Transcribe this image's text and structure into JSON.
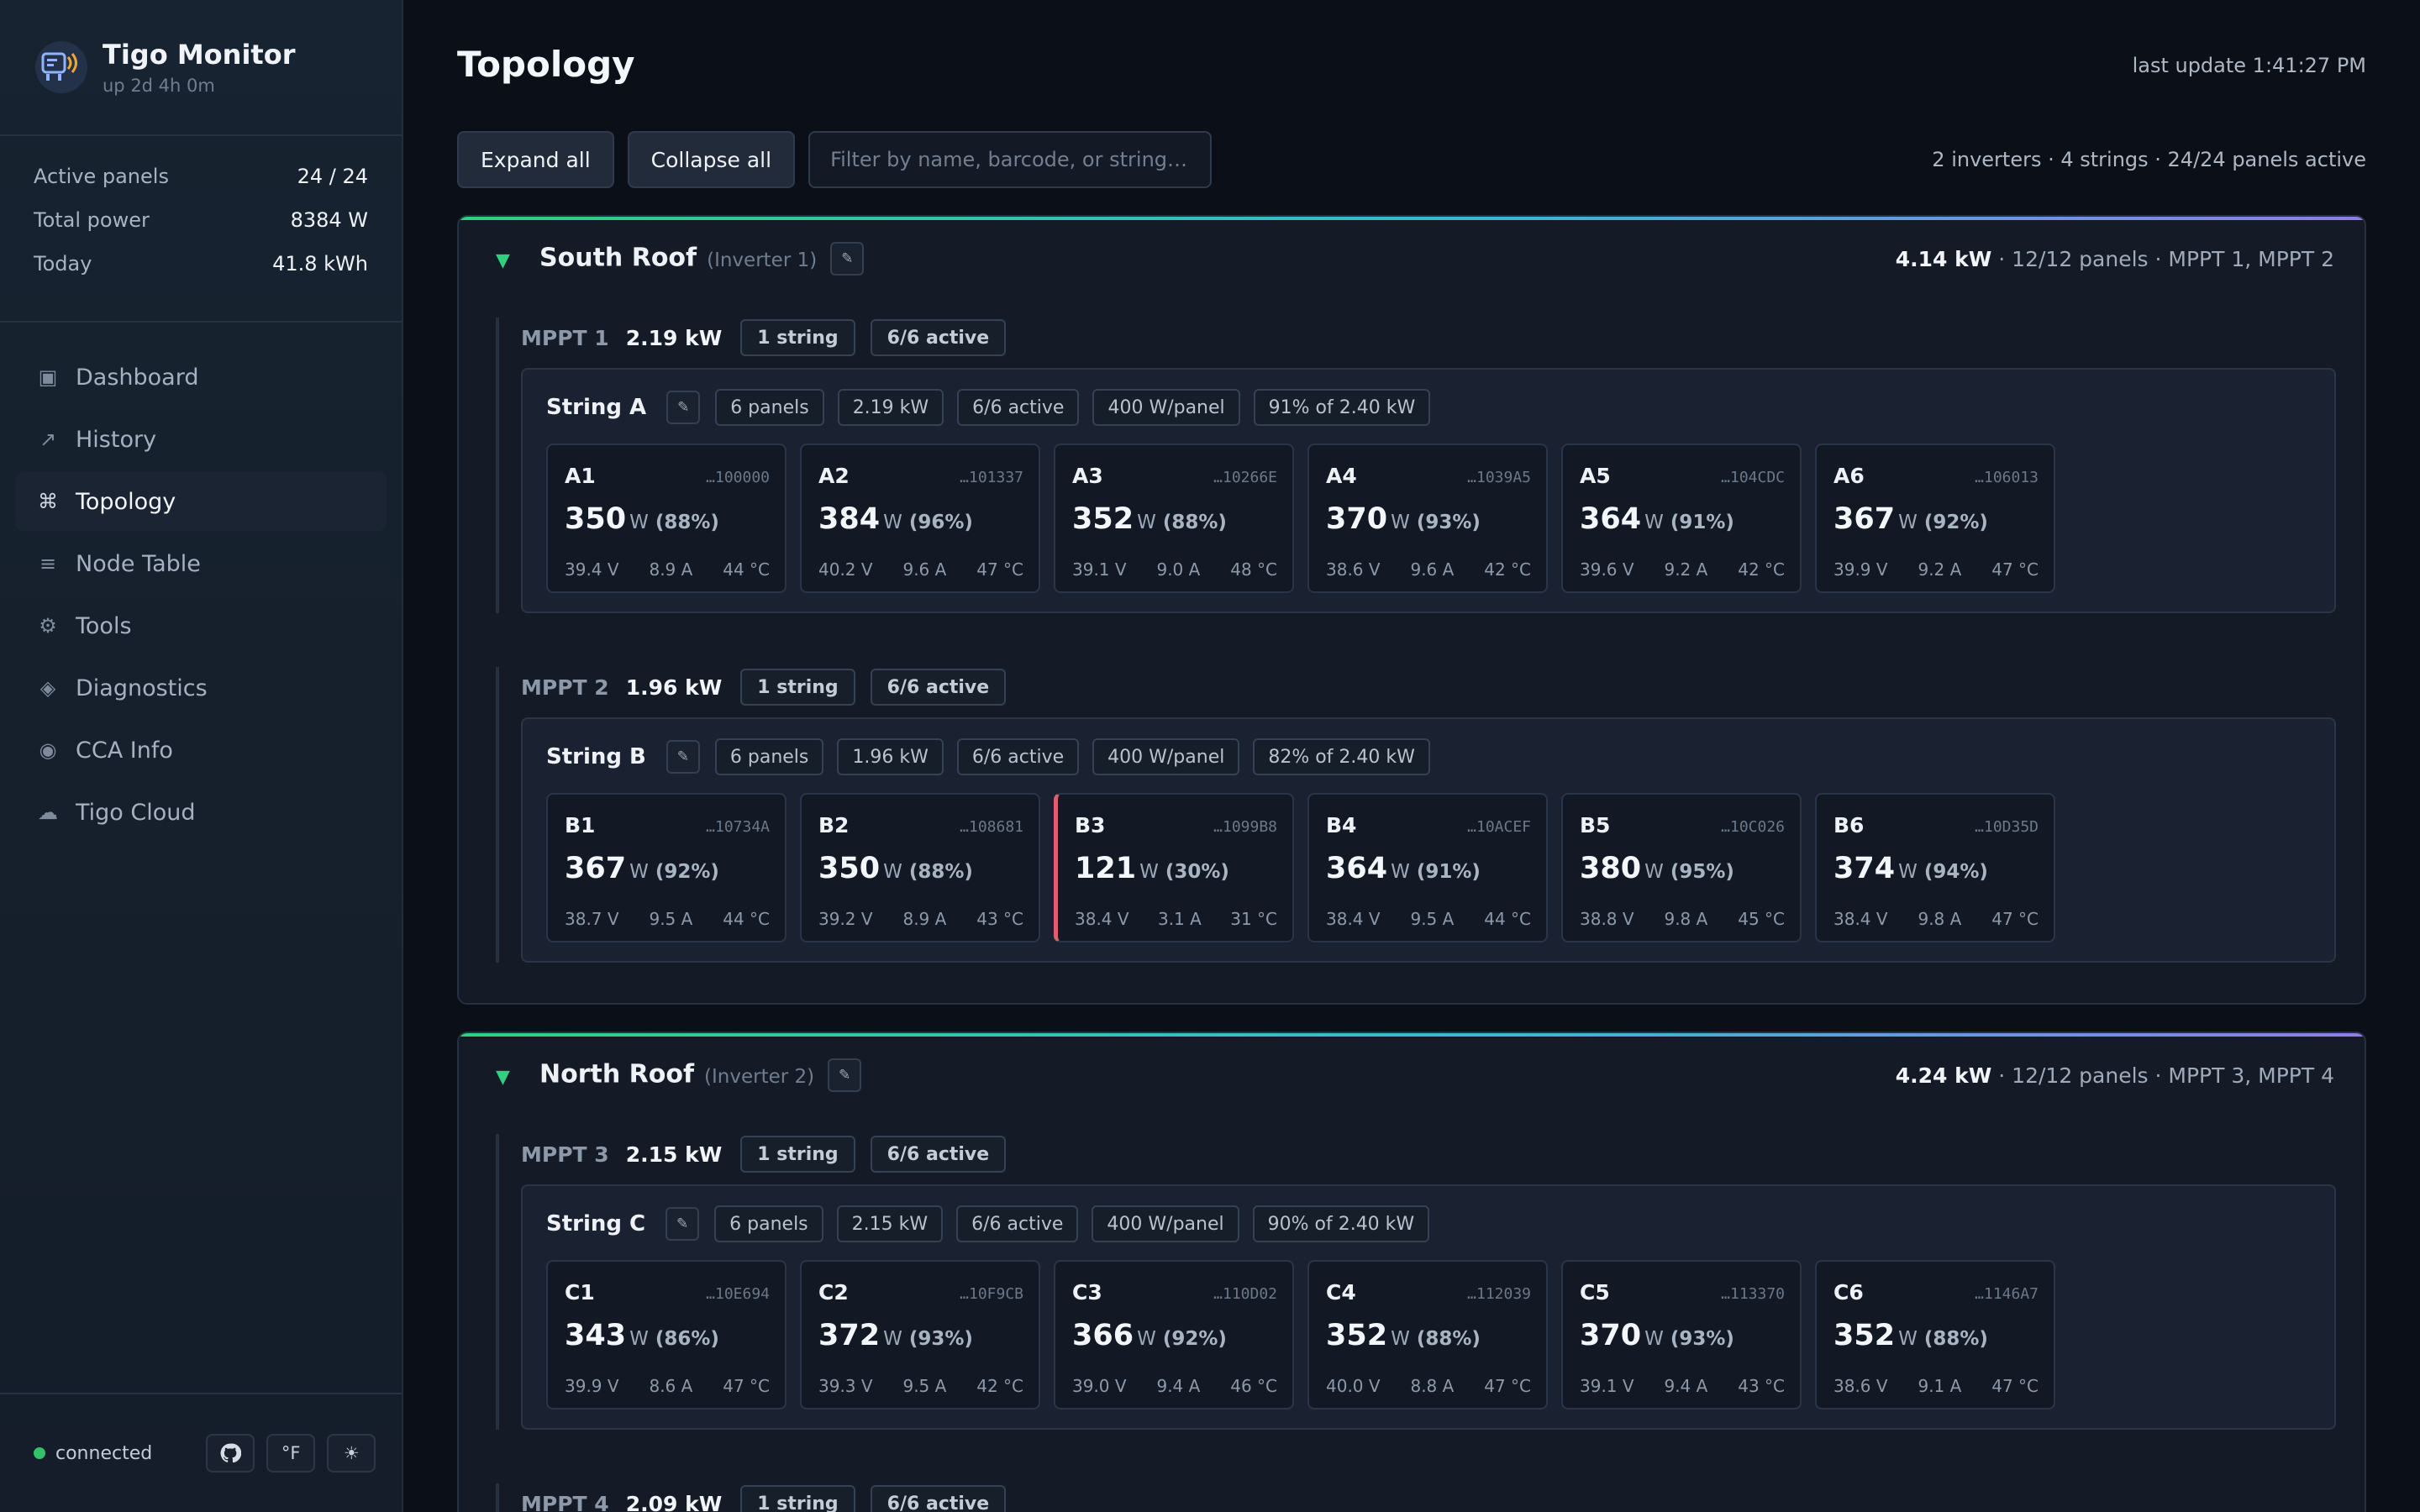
{
  "app": {
    "title": "Tigo Monitor",
    "uptime": "up 2d 4h 0m"
  },
  "stats": [
    {
      "label": "Active panels",
      "value": "24 / 24"
    },
    {
      "label": "Total power",
      "value": "8384 W"
    },
    {
      "label": "Today",
      "value": "41.8 kWh"
    }
  ],
  "nav": [
    {
      "label": "Dashboard",
      "icon": "▣",
      "icon_name": "dashboard-icon",
      "active": false
    },
    {
      "label": "History",
      "icon": "↗",
      "icon_name": "history-icon",
      "active": false
    },
    {
      "label": "Topology",
      "icon": "⌘",
      "icon_name": "topology-icon",
      "active": true
    },
    {
      "label": "Node Table",
      "icon": "≡",
      "icon_name": "node-table-icon",
      "active": false
    },
    {
      "label": "Tools",
      "icon": "⚙",
      "icon_name": "tools-icon",
      "active": false
    },
    {
      "label": "Diagnostics",
      "icon": "◈",
      "icon_name": "diagnostics-icon",
      "active": false
    },
    {
      "label": "CCA Info",
      "icon": "◉",
      "icon_name": "cca-info-icon",
      "active": false
    },
    {
      "label": "Tigo Cloud",
      "icon": "☁",
      "icon_name": "cloud-icon",
      "active": false
    }
  ],
  "footer": {
    "status": "connected",
    "unit_toggle": "°F",
    "theme_icon": "☀"
  },
  "page": {
    "title": "Topology",
    "last_update": "last update 1:41:27 PM",
    "expand_all": "Expand all",
    "collapse_all": "Collapse all",
    "filter_placeholder": "Filter by name, barcode, or string…",
    "summary": "2 inverters · 4 strings · 24/24 panels active"
  },
  "inverters": [
    {
      "name": "South Roof",
      "sub": "(Inverter 1)",
      "power": "4.14 kW",
      "detail": " · 12/12 panels · MPPT 1, MPPT 2",
      "mppts": [
        {
          "label": "MPPT 1",
          "power": "2.19 kW",
          "strings": "1 string",
          "active": "6/6 active",
          "string": {
            "name": "String A",
            "chips": [
              "6 panels",
              "2.19 kW",
              "6/6 active",
              "400 W/panel",
              "91% of 2.40 kW"
            ],
            "panels": [
              {
                "id": "A1",
                "barcode": "…100000",
                "power": "350",
                "unit": "W",
                "pct": "(88%)",
                "v": "39.4 V",
                "a": "8.9 A",
                "t": "44 °C",
                "warn": false
              },
              {
                "id": "A2",
                "barcode": "…101337",
                "power": "384",
                "unit": "W",
                "pct": "(96%)",
                "v": "40.2 V",
                "a": "9.6 A",
                "t": "47 °C",
                "warn": false
              },
              {
                "id": "A3",
                "barcode": "…10266E",
                "power": "352",
                "unit": "W",
                "pct": "(88%)",
                "v": "39.1 V",
                "a": "9.0 A",
                "t": "48 °C",
                "warn": false
              },
              {
                "id": "A4",
                "barcode": "…1039A5",
                "power": "370",
                "unit": "W",
                "pct": "(93%)",
                "v": "38.6 V",
                "a": "9.6 A",
                "t": "42 °C",
                "warn": false
              },
              {
                "id": "A5",
                "barcode": "…104CDC",
                "power": "364",
                "unit": "W",
                "pct": "(91%)",
                "v": "39.6 V",
                "a": "9.2 A",
                "t": "42 °C",
                "warn": false
              },
              {
                "id": "A6",
                "barcode": "…106013",
                "power": "367",
                "unit": "W",
                "pct": "(92%)",
                "v": "39.9 V",
                "a": "9.2 A",
                "t": "47 °C",
                "warn": false
              }
            ]
          }
        },
        {
          "label": "MPPT 2",
          "power": "1.96 kW",
          "strings": "1 string",
          "active": "6/6 active",
          "string": {
            "name": "String B",
            "chips": [
              "6 panels",
              "1.96 kW",
              "6/6 active",
              "400 W/panel",
              "82% of 2.40 kW"
            ],
            "panels": [
              {
                "id": "B1",
                "barcode": "…10734A",
                "power": "367",
                "unit": "W",
                "pct": "(92%)",
                "v": "38.7 V",
                "a": "9.5 A",
                "t": "44 °C",
                "warn": false
              },
              {
                "id": "B2",
                "barcode": "…108681",
                "power": "350",
                "unit": "W",
                "pct": "(88%)",
                "v": "39.2 V",
                "a": "8.9 A",
                "t": "43 °C",
                "warn": false
              },
              {
                "id": "B3",
                "barcode": "…1099B8",
                "power": "121",
                "unit": "W",
                "pct": "(30%)",
                "v": "38.4 V",
                "a": "3.1 A",
                "t": "31 °C",
                "warn": true
              },
              {
                "id": "B4",
                "barcode": "…10ACEF",
                "power": "364",
                "unit": "W",
                "pct": "(91%)",
                "v": "38.4 V",
                "a": "9.5 A",
                "t": "44 °C",
                "warn": false
              },
              {
                "id": "B5",
                "barcode": "…10C026",
                "power": "380",
                "unit": "W",
                "pct": "(95%)",
                "v": "38.8 V",
                "a": "9.8 A",
                "t": "45 °C",
                "warn": false
              },
              {
                "id": "B6",
                "barcode": "…10D35D",
                "power": "374",
                "unit": "W",
                "pct": "(94%)",
                "v": "38.4 V",
                "a": "9.8 A",
                "t": "47 °C",
                "warn": false
              }
            ]
          }
        }
      ]
    },
    {
      "name": "North Roof",
      "sub": "(Inverter 2)",
      "power": "4.24 kW",
      "detail": " · 12/12 panels · MPPT 3, MPPT 4",
      "mppts": [
        {
          "label": "MPPT 3",
          "power": "2.15 kW",
          "strings": "1 string",
          "active": "6/6 active",
          "string": {
            "name": "String C",
            "chips": [
              "6 panels",
              "2.15 kW",
              "6/6 active",
              "400 W/panel",
              "90% of 2.40 kW"
            ],
            "panels": [
              {
                "id": "C1",
                "barcode": "…10E694",
                "power": "343",
                "unit": "W",
                "pct": "(86%)",
                "v": "39.9 V",
                "a": "8.6 A",
                "t": "47 °C",
                "warn": false
              },
              {
                "id": "C2",
                "barcode": "…10F9CB",
                "power": "372",
                "unit": "W",
                "pct": "(93%)",
                "v": "39.3 V",
                "a": "9.5 A",
                "t": "42 °C",
                "warn": false
              },
              {
                "id": "C3",
                "barcode": "…110D02",
                "power": "366",
                "unit": "W",
                "pct": "(92%)",
                "v": "39.0 V",
                "a": "9.4 A",
                "t": "46 °C",
                "warn": false
              },
              {
                "id": "C4",
                "barcode": "…112039",
                "power": "352",
                "unit": "W",
                "pct": "(88%)",
                "v": "40.0 V",
                "a": "8.8 A",
                "t": "47 °C",
                "warn": false
              },
              {
                "id": "C5",
                "barcode": "…113370",
                "power": "370",
                "unit": "W",
                "pct": "(93%)",
                "v": "39.1 V",
                "a": "9.4 A",
                "t": "43 °C",
                "warn": false
              },
              {
                "id": "C6",
                "barcode": "…1146A7",
                "power": "352",
                "unit": "W",
                "pct": "(88%)",
                "v": "38.6 V",
                "a": "9.1 A",
                "t": "47 °C",
                "warn": false
              }
            ]
          }
        },
        {
          "label": "MPPT 4",
          "power": "2.09 kW",
          "strings": "1 string",
          "active": "6/6 active"
        }
      ]
    }
  ]
}
